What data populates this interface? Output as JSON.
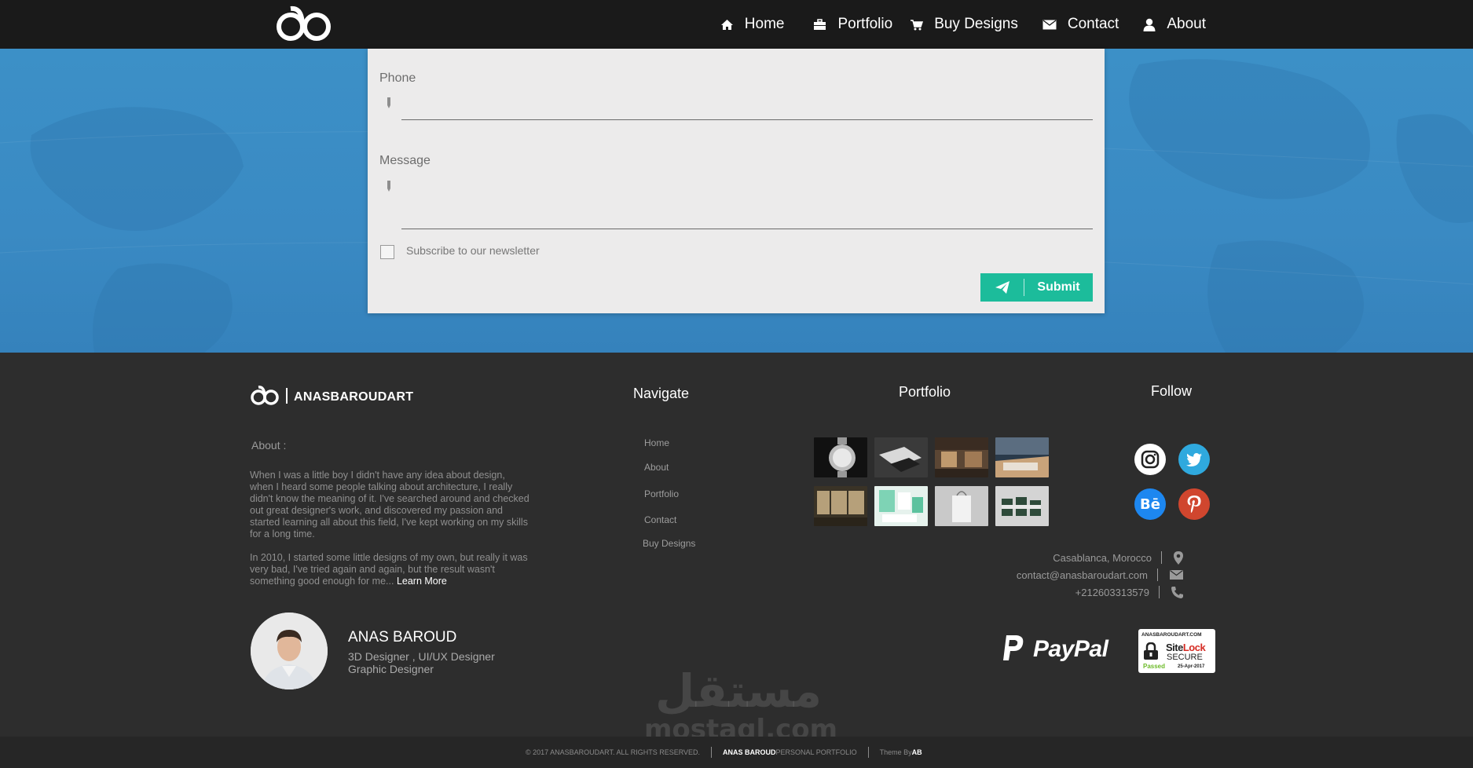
{
  "nav": {
    "items": [
      {
        "label": "Home",
        "icon": "home-icon"
      },
      {
        "label": "Portfolio",
        "icon": "briefcase-icon"
      },
      {
        "label": "Buy Designs",
        "icon": "cart-icon"
      },
      {
        "label": "Contact",
        "icon": "envelope-icon"
      },
      {
        "label": "About",
        "icon": "user-icon"
      }
    ]
  },
  "form": {
    "phone_label": "Phone",
    "message_label": "Message",
    "newsletter_label": "Subscribe to our newsletter",
    "newsletter_checked": false,
    "submit_label": "Submit",
    "accent": "#1cbc9b"
  },
  "footer": {
    "brand": "ANASBAROUDART",
    "about_heading": "About :",
    "about_p1": "When I was a little boy I didn't have any idea about design, when I heard some people talking about architecture, I really didn't know the meaning of it. I've searched around and checked out great designer's work, and discovered my passion and started learning all about this field, I've kept working on my skills for a long time.",
    "about_p2": "In 2010, I started some little designs of my own, but really it was very bad, I've tried again and again, but the result wasn't something good enough for me...",
    "learn_more": "Learn More",
    "person_name": "ANAS BAROUD",
    "person_role1": "3D Designer , UI/UX Designer",
    "person_role2": "Graphic Designer",
    "navigate_heading": "Navigate",
    "navigate_links": [
      "Home",
      "About",
      "Portfolio",
      "Contact",
      "Buy Designs"
    ],
    "portfolio_heading": "Portfolio",
    "follow_heading": "Follow",
    "social": [
      "instagram-icon",
      "twitter-icon",
      "behance-icon",
      "pinterest-icon"
    ],
    "location": "Casablanca, Morocco",
    "email": "contact@anasbaroudart.com",
    "phone": "+212603313579",
    "paypal": "PayPal",
    "sitelock_domain": "ANASBAROUDART.COM",
    "sitelock_name1": "Site",
    "sitelock_name2": "Lock",
    "sitelock_secure": "SECURE",
    "sitelock_passed": "Passed",
    "sitelock_date": "25-Apr-2017",
    "watermark_ar": "مستقل",
    "watermark_lat": "mostaql.com"
  },
  "bottom": {
    "copyright": "© 2017 ANASBAROUDART. ALL RIGHTS RESERVED.",
    "owner": "ANAS BAROUD",
    "owner_suffix": " PERSONAL PORTFOLIO",
    "theme_by": "Theme By ",
    "theme_author": "AB"
  }
}
